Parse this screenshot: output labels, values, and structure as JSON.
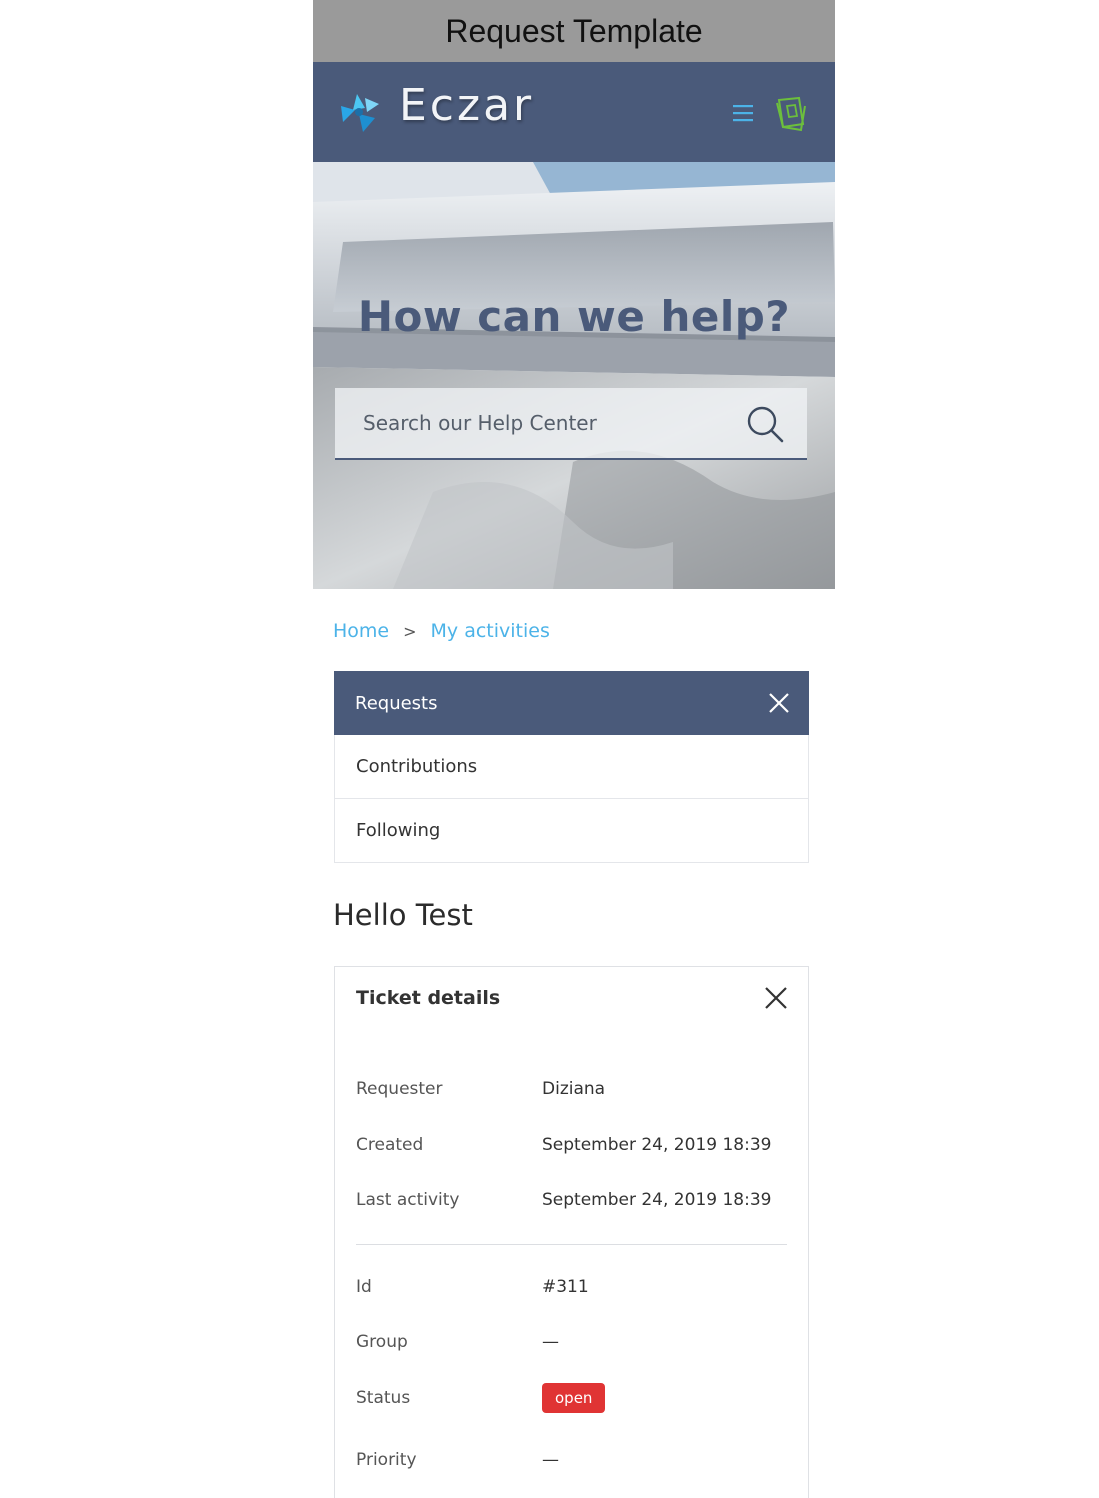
{
  "template_bar": {
    "title": "Request Template"
  },
  "header": {
    "brand": "Eczar",
    "menu_icon": "hamburger-menu-icon",
    "book_icon": "book-icon",
    "colors": {
      "background": "#4a5a7a",
      "menu_accent": "#4cb3e8",
      "book_accent": "#6cbf3c"
    }
  },
  "hero": {
    "title": "How can we help?",
    "search": {
      "placeholder": "Search our Help Center",
      "value": ""
    }
  },
  "breadcrumb": {
    "items": [
      "Home",
      "My activities"
    ],
    "separator": ">"
  },
  "tabs": [
    {
      "label": "Requests",
      "active": true
    },
    {
      "label": "Contributions",
      "active": false
    },
    {
      "label": "Following",
      "active": false
    }
  ],
  "greeting": "Hello Test",
  "ticket": {
    "title": "Ticket details",
    "fields": [
      {
        "label": "Requester",
        "value": "Diziana"
      },
      {
        "label": "Created",
        "value": "September 24, 2019 18:39"
      },
      {
        "label": "Last activity",
        "value": "September 24, 2019 18:39"
      },
      {
        "label": "Id",
        "value": "#311"
      },
      {
        "label": "Group",
        "value": "—"
      },
      {
        "label": "Status",
        "value": "open"
      },
      {
        "label": "Priority",
        "value": "—"
      }
    ],
    "status_color": "#e03434"
  }
}
